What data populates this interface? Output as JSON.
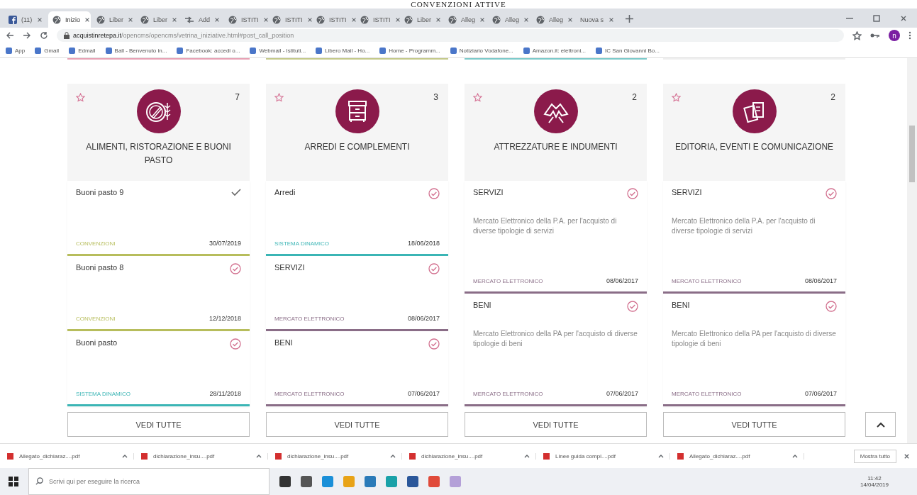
{
  "page_heading": "CONVENZIONI ATTIVE",
  "browser": {
    "tabs": [
      {
        "title": "(11)",
        "selected": false
      },
      {
        "title": "Inizio",
        "selected": true
      },
      {
        "title": "Liber",
        "selected": false
      },
      {
        "title": "Liber",
        "selected": false
      },
      {
        "title": "Add",
        "selected": false
      },
      {
        "title": "ISTITI",
        "selected": false
      },
      {
        "title": "ISTITI",
        "selected": false
      },
      {
        "title": "ISTITI",
        "selected": false
      },
      {
        "title": "ISTITI",
        "selected": false
      },
      {
        "title": "Liber",
        "selected": false
      },
      {
        "title": "Alleg",
        "selected": false
      },
      {
        "title": "Alleg",
        "selected": false
      },
      {
        "title": "Alleg",
        "selected": false
      },
      {
        "title": "Nuova s",
        "selected": false
      }
    ],
    "address": {
      "host": "acquistinretepa.it",
      "path": "/opencms/opencms/vetrina_iniziative.html#post_call_position"
    },
    "profile_initial": "n",
    "bookmarks": [
      "App",
      "Gmail",
      "Edmail",
      "Ball - Benvenuto in...",
      "Facebook: accedi o...",
      "Webmail - Istituti...",
      "Libero Mail - Ho...",
      "Home - Programm...",
      "Notiziario Vodafone...",
      "Amazon.it: elettroni...",
      "IC San Giovanni Bo..."
    ]
  },
  "categories": [
    {
      "title": "ALIMENTI, RISTORAZIONE E BUONI PASTO",
      "count": "7",
      "see_all": "VEDI TUTTE",
      "items": [
        {
          "title": "Buoni pasto 9",
          "kind": "tick",
          "channel": "CONVENZIONI",
          "date": "30/07/2019",
          "color": "#b7bd5c"
        },
        {
          "title": "Buoni pasto 8",
          "kind": "circle",
          "channel": "CONVENZIONI",
          "date": "12/12/2018",
          "color": "#b7bd5c"
        },
        {
          "title": "Buoni pasto",
          "kind": "circle",
          "channel": "SISTEMA DINAMICO",
          "date": "28/11/2018",
          "color": "#3bb5b5"
        }
      ]
    },
    {
      "title": "ARREDI E COMPLEMENTI",
      "count": "3",
      "see_all": "VEDI TUTTE",
      "items": [
        {
          "title": "Arredi",
          "kind": "circle",
          "channel": "SISTEMA DINAMICO",
          "date": "18/06/2018",
          "color": "#3bb5b5"
        },
        {
          "title": "SERVIZI",
          "kind": "circle",
          "channel": "MERCATO ELETTRONICO",
          "date": "08/06/2017",
          "color": "#8a6d87"
        },
        {
          "title": "BENI",
          "kind": "circle",
          "channel": "MERCATO ELETTRONICO",
          "date": "07/06/2017",
          "color": "#8a6d87"
        }
      ]
    },
    {
      "title": "ATTREZZATURE E INDUMENTI",
      "count": "2",
      "see_all": "VEDI TUTTE",
      "items": [
        {
          "title": "SERVIZI",
          "description": "Mercato Elettronico della P.A. per l'acquisto di diverse tipologie di servizi",
          "kind": "circle",
          "channel": "MERCATO ELETTRONICO",
          "date": "08/06/2017",
          "color": "#8a6d87"
        },
        {
          "title": "BENI",
          "description": "Mercato Elettronico della PA per l'acquisto di diverse tipologie di beni",
          "kind": "circle",
          "channel": "MERCATO ELETTRONICO",
          "date": "07/06/2017",
          "color": "#8a6d87"
        }
      ]
    },
    {
      "title": "EDITORIA, EVENTI E COMUNICAZIONE",
      "count": "2",
      "see_all": "VEDI TUTTE",
      "items": [
        {
          "title": "SERVIZI",
          "description": "Mercato Elettronico della P.A. per l'acquisto di diverse tipologie di servizi",
          "kind": "circle",
          "channel": "MERCATO ELETTRONICO",
          "date": "08/06/2017",
          "color": "#8a6d87"
        },
        {
          "title": "BENI",
          "description": "Mercato Elettronico della PA per l'acquisto di diverse tipologie di beni",
          "kind": "circle",
          "channel": "MERCATO ELETTRONICO",
          "date": "07/06/2017",
          "color": "#8a6d87"
        }
      ]
    }
  ],
  "downloads": {
    "files": [
      "Allegato_dichiaraz....pdf",
      "dichiarazione_insu....pdf",
      "dichiarazione_insu....pdf",
      "dichiarazione_insu....pdf",
      "Linee guida compl....pdf",
      "Allegato_dichiaraz....pdf"
    ],
    "show_all": "Mostra tutto"
  },
  "taskbar": {
    "search_placeholder": "Scrivi qui per eseguire la ricerca",
    "time": "11:42",
    "date": "14/04/2019"
  }
}
